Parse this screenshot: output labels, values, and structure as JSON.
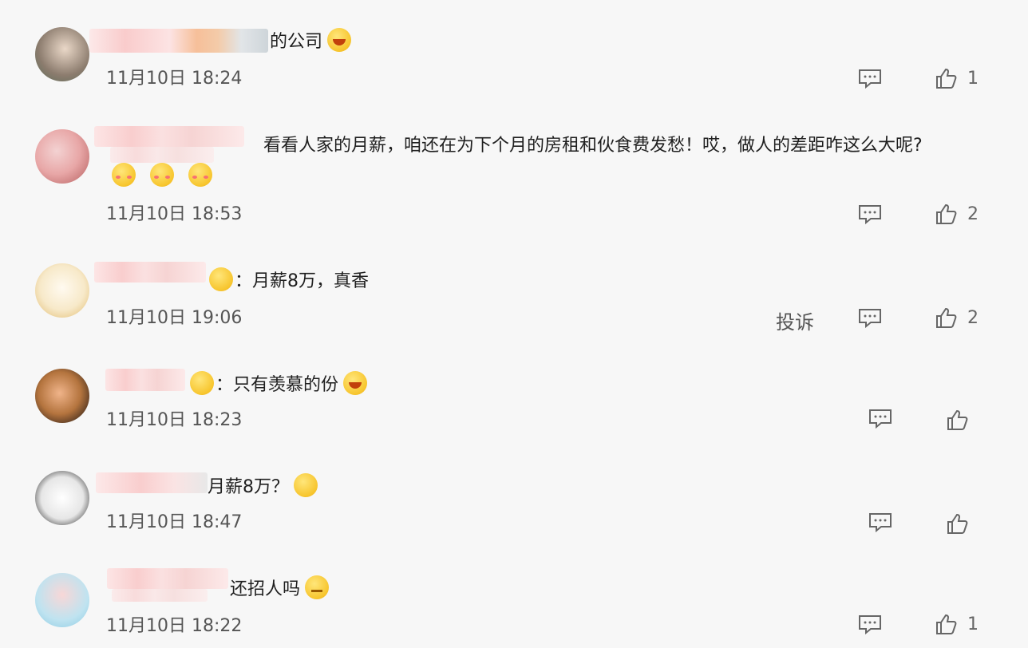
{
  "comments": [
    {
      "text": "的公司",
      "emoji": "laugh-cry-emoji",
      "time": "11月10日 18:24",
      "likes": "1",
      "report": ""
    },
    {
      "text": "看看人家的月薪，咱还在为下个月的房租和伙食费发愁！哎，做人的差距咋这么大呢?",
      "emoji": "shy-emoji x3",
      "time": "11月10日 18:53",
      "likes": "2",
      "report": ""
    },
    {
      "text": "：月薪8万，真香",
      "emoji": "heart-eyes-emoji",
      "time": "11月10日 19:06",
      "likes": "2",
      "report": "投诉"
    },
    {
      "text": "：只有羡慕的份",
      "emoji": "laugh-cry-emoji",
      "time": "11月10日 18:23",
      "likes": "",
      "report": ""
    },
    {
      "text": "月薪8万？",
      "emoji": "hammer-emoji",
      "time": "11月10日 18:47",
      "likes": "",
      "report": ""
    },
    {
      "text": "还招人吗",
      "emoji": "thinking-emoji",
      "time": "11月10日 18:22",
      "likes": "1",
      "report": ""
    }
  ],
  "colors": {
    "background": "#f7f7f7",
    "icon": "#666666"
  }
}
